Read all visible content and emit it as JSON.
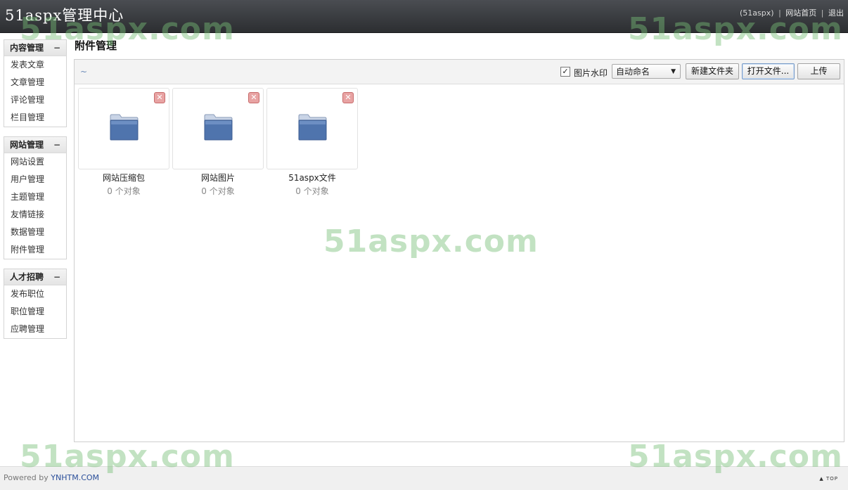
{
  "header": {
    "title": "51aspx管理中心",
    "user": "(51aspx)",
    "site_home": "网站首页",
    "logout": "退出",
    "sep": "|"
  },
  "sidebar": [
    {
      "title": "内容管理",
      "toggle": "−",
      "items": [
        "发表文章",
        "文章管理",
        "评论管理",
        "栏目管理"
      ]
    },
    {
      "title": "网站管理",
      "toggle": "−",
      "items": [
        "网站设置",
        "用户管理",
        "主题管理",
        "友情链接",
        "数据管理",
        "附件管理"
      ]
    },
    {
      "title": "人才招聘",
      "toggle": "−",
      "items": [
        "发布职位",
        "职位管理",
        "应聘管理"
      ]
    }
  ],
  "main": {
    "title": "附件管理",
    "toolbar": {
      "path": "~",
      "watermark_checked": "✓",
      "watermark_label": "图片水印",
      "naming_select": "自动命名",
      "select_arrow": "▼",
      "new_folder": "新建文件夹",
      "open_file": "打开文件...",
      "upload": "上传"
    },
    "folders": [
      {
        "name": "网站压缩包",
        "count": "0 个对象"
      },
      {
        "name": "网站图片",
        "count": "0 个对象"
      },
      {
        "name": "51aspx文件",
        "count": "0 个对象"
      }
    ],
    "delete_glyph": "✕"
  },
  "footer": {
    "powered_prefix": "Powered by",
    "powered_brand": "YNHTM.COM",
    "top": "▲ TOP"
  },
  "watermark_text": "51aspx.com",
  "colors": {
    "header_bg": "#35383b",
    "folder_blue": "#4f74ad",
    "link_blue": "#2b4f9a",
    "watermark_green": "#78be78"
  }
}
